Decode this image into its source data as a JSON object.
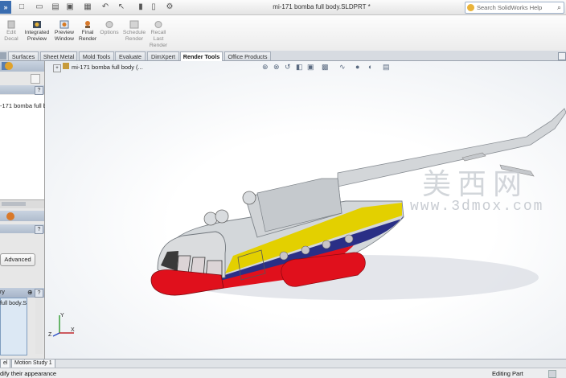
{
  "titlebar": {
    "doc_title": "mi-171 bomba full body.SLDPRT *",
    "search_placeholder": "Search SolidWorks Help"
  },
  "ribbon": {
    "buttons": [
      {
        "label": "Edit\nDecal",
        "icon": "decal-icon"
      },
      {
        "label": "Integrated\nPreview",
        "icon": "integrated-preview-icon"
      },
      {
        "label": "Preview\nWindow",
        "icon": "preview-window-icon"
      },
      {
        "label": "Final\nRender",
        "icon": "final-render-icon"
      },
      {
        "label": "Options",
        "icon": "options-icon"
      },
      {
        "label": "Schedule\nRender",
        "icon": "schedule-render-icon"
      },
      {
        "label": "Recall\nLast\nRender",
        "icon": "recall-render-icon"
      }
    ]
  },
  "tabs": [
    "Surfaces",
    "Sheet Metal",
    "Mold Tools",
    "Evaluate",
    "DimXpert",
    "Render Tools",
    "Office Products"
  ],
  "active_tab": "Render Tools",
  "left_panel": {
    "feature_item": "-171 bomba full bo",
    "advanced_button": "Advanced",
    "section_label": "ry",
    "file_item": "full body.S"
  },
  "graphics": {
    "tree_root": "mi-171 bomba full body  (...",
    "watermark_cn": "美西网",
    "watermark_url": "www.3dmox.com",
    "triad_axes": [
      "X",
      "Y",
      "Z"
    ]
  },
  "bottom_tabs": [
    "el",
    "Motion Study 1"
  ],
  "status": {
    "message": "dify their appearance",
    "mode": "Editing Part"
  },
  "colors": {
    "fuselage": "#cfd3d6",
    "nose_red": "#e0101c",
    "stripe_yellow": "#e3d000",
    "stripe_blue": "#2a2f86",
    "accent": "#3a6db0"
  }
}
